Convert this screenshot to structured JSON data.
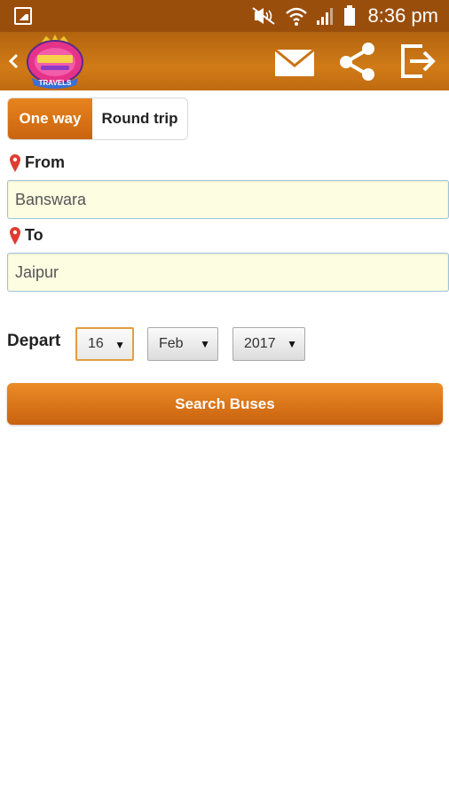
{
  "status_bar": {
    "time": "8:36 pm",
    "icons": [
      "gallery-icon",
      "mute-icon",
      "wifi-icon",
      "signal-icon",
      "battery-icon"
    ]
  },
  "app_bar": {
    "logo_text": "TRAVELS",
    "actions": [
      "mail-icon",
      "share-icon",
      "exit-icon"
    ]
  },
  "trip_type": {
    "options": [
      "One way",
      "Round trip"
    ],
    "selected": "One way"
  },
  "from": {
    "label": "From",
    "value": "Banswara"
  },
  "to": {
    "label": "To",
    "value": "Jaipur"
  },
  "depart": {
    "label": "Depart",
    "day": "16",
    "month": "Feb",
    "year": "2017"
  },
  "search_button": "Search Buses",
  "colors": {
    "status_bar": "#9a4e0c",
    "app_bar": "#c87416",
    "accent": "#d9731a",
    "input_bg": "#fdfde2",
    "pin": "#e03c31"
  }
}
